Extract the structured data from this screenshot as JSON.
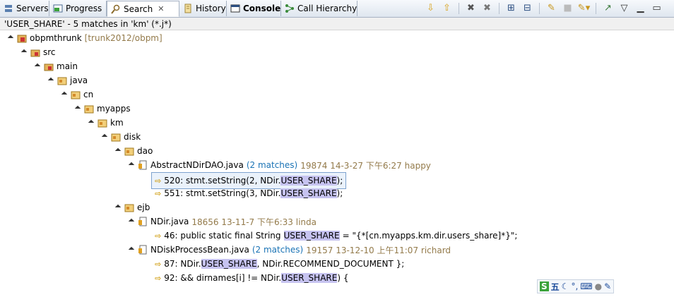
{
  "tabs": [
    {
      "label": "Servers",
      "icon": "servers-icon",
      "active": false,
      "bold": false
    },
    {
      "label": "Progress",
      "icon": "progress-icon",
      "active": false,
      "bold": false
    },
    {
      "label": "Search",
      "icon": "search-icon",
      "active": true,
      "bold": false,
      "closable": true
    },
    {
      "label": "History",
      "icon": "history-icon",
      "active": false,
      "bold": false
    },
    {
      "label": "Console",
      "icon": "console-icon",
      "active": false,
      "bold": true
    },
    {
      "label": "Call Hierarchy",
      "icon": "call-hierarchy-icon",
      "active": false,
      "bold": false
    }
  ],
  "toolbar": [
    "next-match-icon",
    "previous-match-icon",
    "remove-match-icon",
    "remove-all-matches-icon",
    "expand-all-icon",
    "collapse-all-icon",
    "run-search-again-icon",
    "cancel-search-icon",
    "search-history-icon",
    "pin-view-icon",
    "view-menu-icon",
    "minimize-icon",
    "maximize-icon"
  ],
  "summary": "'USER_SHARE' - 5 matches in 'km' (*.j*)",
  "tree": {
    "project": {
      "name": "obpmthrunk",
      "meta": "[trunk2012/obpm]"
    },
    "folders": [
      "src",
      "main",
      "java",
      "cn",
      "myapps",
      "km",
      "disk"
    ],
    "dao": "dao",
    "file1": {
      "name": "AbstractNDirDAO.java",
      "count": "(2 matches)",
      "meta": "19874  14-3-27 下午6:27  happy",
      "m1": {
        "pre": "520: stmt.setString(2, NDir.",
        "hl": "USER_SHARE",
        "post": ");"
      },
      "m2": {
        "pre": "551: stmt.setString(3, NDir.",
        "hl": "USER_SHARE",
        "post": ");"
      }
    },
    "ejb": "ejb",
    "file2": {
      "name": "NDir.java",
      "meta": "18656  13-11-7 下午6:33  linda",
      "m1": {
        "pre": "46: public static final String ",
        "hl": "USER_SHARE",
        "post": " = \"{*[cn.myapps.km.dir.users_share]*}\";"
      }
    },
    "file3": {
      "name": "NDiskProcessBean.java",
      "count": "(2 matches)",
      "meta": "19157  13-12-10 上午11:07  richard",
      "m1": {
        "pre": "87: NDir.",
        "hl": "USER_SHARE",
        "post": ", NDir.RECOMMEND_DOCUMENT };"
      },
      "m2": {
        "pre": "92: && dirnames[i] != NDir.",
        "hl": "USER_SHARE",
        "post": ") {"
      }
    }
  },
  "ime": {
    "label": "五"
  }
}
